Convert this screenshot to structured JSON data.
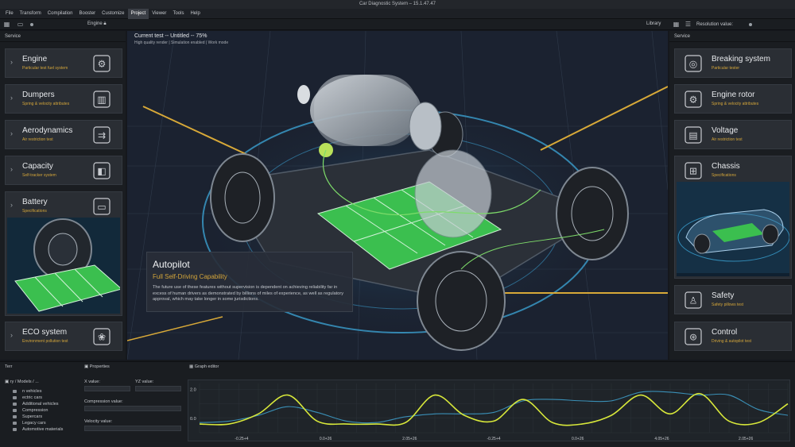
{
  "app": {
    "title": "Car Diagnostic System – 15.1.47.47"
  },
  "menu": {
    "items": [
      "File",
      "Transform",
      "Compilation",
      "Booster",
      "Customize",
      "Project",
      "Viewer",
      "Tools",
      "Help"
    ],
    "active_index": 5
  },
  "toolbar": {
    "engine_label": "Engine",
    "library_label": "Library",
    "resolution_label": "Resolution value:"
  },
  "left_panel": {
    "title": "Service",
    "cards": [
      {
        "title": "Engine",
        "subtitle": "Particular test fuel system",
        "icon": "engine-icon"
      },
      {
        "title": "Dumpers",
        "subtitle": "Spring & velocity attributes",
        "icon": "damper-icon"
      },
      {
        "title": "Aerodynamics",
        "subtitle": "Air restriction test",
        "icon": "aerodynamics-icon"
      },
      {
        "title": "Capacity",
        "subtitle": "Self-tracker system",
        "icon": "capacity-icon"
      },
      {
        "title": "Battery",
        "subtitle": "Specifications",
        "icon": "battery-icon"
      },
      {
        "title": "ECO system",
        "subtitle": "Environment pollution test",
        "icon": "eco-icon"
      }
    ]
  },
  "right_panel": {
    "title": "Service",
    "cards": [
      {
        "title": "Breaking system",
        "subtitle": "Particular tester",
        "icon": "brake-disc-icon"
      },
      {
        "title": "Engine rotor",
        "subtitle": "Spring & velocity attributes",
        "icon": "rotor-icon"
      },
      {
        "title": "Voltage",
        "subtitle": "Air restriction test",
        "icon": "car-battery-icon"
      },
      {
        "title": "Chassis",
        "subtitle": "Specifications",
        "icon": "chassis-icon"
      },
      {
        "title": "Safety",
        "subtitle": "Safety pillows test",
        "icon": "car-seat-icon"
      },
      {
        "title": "Control",
        "subtitle": "Driving & autopilot test",
        "icon": "steering-wheel-icon"
      }
    ]
  },
  "viewport": {
    "title": "Current test -- Untitled -- 75%",
    "subtitle": "High quality render | Simulation enabled | Work mode"
  },
  "autopilot": {
    "title": "Autopilot",
    "subtitle": "Full Self-Driving Capability",
    "body": "The future use of these features without supervision is dependent on achieving reliability far in excess of human drivers as demonstrated by billions of miles of experience, as well as regulatory approval, which may take longer in some jurisdictions."
  },
  "bottom": {
    "tree_head": "Terr",
    "tree_path": "ry / Models / ...",
    "tree_items": [
      "n vehicles",
      "ectric cars",
      "Additional vehicles",
      "Compression",
      "Supercars",
      "Legacy cars",
      "Automotive materials"
    ],
    "props_head": "Properties",
    "x_label": "X value:",
    "yz_label": "YZ value:",
    "compression_label": "Compression value:",
    "velocity_label": "Velocity value:",
    "graph_head": "Graph editor",
    "colors": {
      "yellow": "#d8e83a",
      "blue": "#3a8fb6"
    }
  },
  "chart_data": {
    "type": "line",
    "y_tick_labels": [
      "2.0",
      "0.0"
    ],
    "x_tick_labels": [
      "-0.25+4",
      "0.0+26",
      "2.05+26",
      "-0.25+4",
      "0.0+26",
      "4.05+26",
      "2.05+26"
    ],
    "ylim": [
      -1,
      2.4
    ],
    "x": [
      0,
      0.05,
      0.1,
      0.15,
      0.2,
      0.25,
      0.3,
      0.35,
      0.4,
      0.45,
      0.5,
      0.55,
      0.6,
      0.65,
      0.7,
      0.75,
      0.8,
      0.85,
      0.9,
      0.95,
      1.0
    ],
    "series": [
      {
        "values": [
          -0.3,
          -0.2,
          0.2,
          0.8,
          0.4,
          -0.2,
          -0.3,
          0.1,
          0.3,
          0.3,
          0.4,
          1.2,
          1.3,
          1.2,
          1.2,
          1.8,
          1.8,
          1.6,
          1.6,
          0.6,
          0.2
        ],
        "color": "#3a8fb6"
      },
      {
        "values": [
          -0.4,
          -0.4,
          0.3,
          1.6,
          -0.2,
          -0.4,
          -0.4,
          -0.3,
          1.6,
          0.2,
          -0.2,
          1.3,
          -0.3,
          -0.4,
          0.2,
          1.6,
          0.3,
          1.7,
          -0.2,
          -0.3,
          1.0
        ],
        "color": "#d8e83a"
      }
    ]
  }
}
